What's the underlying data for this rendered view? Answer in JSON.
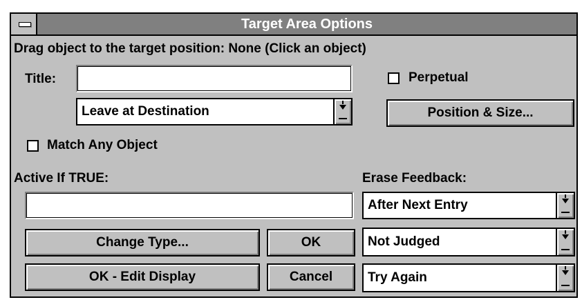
{
  "window": {
    "title": "Target Area Options"
  },
  "instruction": "Drag object to the target position: None (Click an object)",
  "title_field": {
    "label": "Title:",
    "value": ""
  },
  "destination_select": {
    "selected": "Leave at Destination"
  },
  "perpetual": {
    "label": "Perpetual",
    "checked": false
  },
  "position_size_button": "Position & Size...",
  "match_any": {
    "label": "Match Any Object",
    "checked": false
  },
  "active_if": {
    "label": "Active If TRUE:",
    "value": ""
  },
  "erase_feedback": {
    "label": "Erase Feedback:",
    "selected": "After Next Entry"
  },
  "judged_select": {
    "selected": "Not Judged"
  },
  "try_again_select": {
    "selected": "Try Again"
  },
  "buttons": {
    "change_type": "Change Type...",
    "ok": "OK",
    "ok_edit_display": "OK - Edit Display",
    "cancel": "Cancel"
  },
  "colors": {
    "title_bar": "#808080",
    "dialog_bg": "#c0c0c0",
    "field_bg": "#ffffff"
  },
  "icons": {
    "system_menu": "system-menu-icon",
    "dropdown": "dropdown-arrow-icon"
  }
}
